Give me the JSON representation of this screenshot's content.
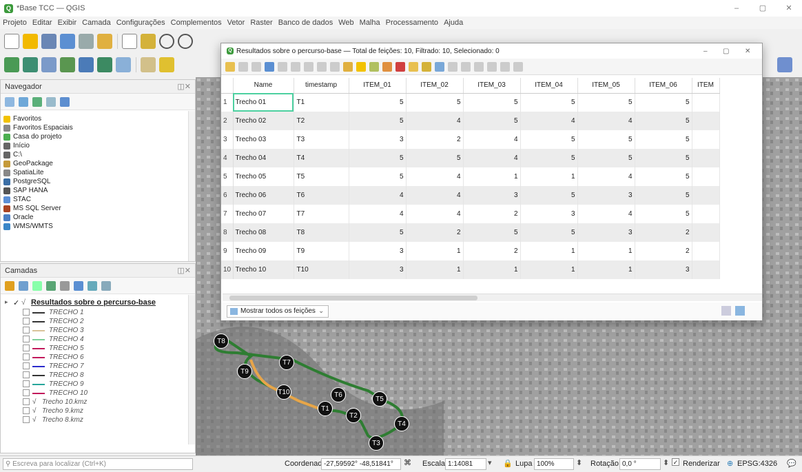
{
  "window": {
    "title": "*Base TCC — QGIS",
    "minimize": "–",
    "restore": "▢",
    "close": "✕"
  },
  "menu": [
    "Projeto",
    "Editar",
    "Exibir",
    "Camada",
    "Configurações",
    "Complementos",
    "Vetor",
    "Raster",
    "Banco de dados",
    "Web",
    "Malha",
    "Processamento",
    "Ajuda"
  ],
  "navigator": {
    "title": "Navegador",
    "items": [
      {
        "label": "Favoritos",
        "icon": "star-icon",
        "color": "#f2c200"
      },
      {
        "label": "Favoritos Espaciais",
        "icon": "spatial-bookmark-icon",
        "color": "#888"
      },
      {
        "label": "Casa do projeto",
        "icon": "project-home-icon",
        "color": "#4caf50"
      },
      {
        "label": "Início",
        "icon": "home-icon",
        "color": "#666"
      },
      {
        "label": "C:\\",
        "icon": "drive-icon",
        "color": "#666"
      },
      {
        "label": "GeoPackage",
        "icon": "geopackage-icon",
        "color": "#c59a3a"
      },
      {
        "label": "SpatiaLite",
        "icon": "spatialite-icon",
        "color": "#888"
      },
      {
        "label": "PostgreSQL",
        "icon": "postgresql-icon",
        "color": "#3b6ea5"
      },
      {
        "label": "SAP HANA",
        "icon": "sap-hana-icon",
        "color": "#555"
      },
      {
        "label": "STAC",
        "icon": "stac-icon",
        "color": "#5b8fd6"
      },
      {
        "label": "MS SQL Server",
        "icon": "mssql-icon",
        "color": "#a42"
      },
      {
        "label": "Oracle",
        "icon": "oracle-icon",
        "color": "#4a7fc4"
      },
      {
        "label": "WMS/WMTS",
        "icon": "wms-icon",
        "color": "#3a86c8"
      }
    ]
  },
  "layers": {
    "title": "Camadas",
    "group": "Resultados sobre o percurso-base",
    "items": [
      {
        "label": "TRECHO 1",
        "color": "#333333"
      },
      {
        "label": "TRECHO 2",
        "color": "#333333"
      },
      {
        "label": "TRECHO 3",
        "color": "#d9c39a"
      },
      {
        "label": "TRECHO 4",
        "color": "#7fcf9a"
      },
      {
        "label": "TRECHO 5",
        "color": "#c2185b"
      },
      {
        "label": "TRECHO 6",
        "color": "#c2185b"
      },
      {
        "label": "TRECHO 7",
        "color": "#2a2acc"
      },
      {
        "label": "TRECHO 8",
        "color": "#333333"
      },
      {
        "label": "TRECHO 9",
        "color": "#26a69a"
      },
      {
        "label": "TRECHO 10",
        "color": "#c2185b"
      }
    ],
    "extra": [
      "Trecho 10.kmz",
      "Trecho 9.kmz",
      "Trecho 8.kmz"
    ]
  },
  "search": {
    "placeholder": "Escreva para localizar (Ctrl+K)"
  },
  "attr": {
    "title": "Resultados sobre o percurso-base — Total de feições: 10, Filtrado: 10, Selecionado: 0",
    "columns": [
      "Name",
      "timestamp",
      "ITEM_01",
      "ITEM_02",
      "ITEM_03",
      "ITEM_04",
      "ITEM_05",
      "ITEM_06",
      "ITEM"
    ],
    "rows": [
      {
        "n": "1",
        "name": "Trecho 01",
        "ts": "T1",
        "v": [
          "5",
          "5",
          "5",
          "5",
          "5",
          "5"
        ]
      },
      {
        "n": "2",
        "name": "Trecho 02",
        "ts": "T2",
        "v": [
          "5",
          "4",
          "5",
          "4",
          "4",
          "5"
        ]
      },
      {
        "n": "3",
        "name": "Trecho 03",
        "ts": "T3",
        "v": [
          "3",
          "2",
          "4",
          "5",
          "5",
          "5"
        ]
      },
      {
        "n": "4",
        "name": "Trecho 04",
        "ts": "T4",
        "v": [
          "5",
          "5",
          "4",
          "5",
          "5",
          "5"
        ]
      },
      {
        "n": "5",
        "name": "Trecho 05",
        "ts": "T5",
        "v": [
          "5",
          "4",
          "1",
          "1",
          "4",
          "5"
        ]
      },
      {
        "n": "6",
        "name": "Trecho 06",
        "ts": "T6",
        "v": [
          "4",
          "4",
          "3",
          "5",
          "3",
          "5"
        ]
      },
      {
        "n": "7",
        "name": "Trecho 07",
        "ts": "T7",
        "v": [
          "4",
          "4",
          "2",
          "3",
          "4",
          "5"
        ]
      },
      {
        "n": "8",
        "name": "Trecho 08",
        "ts": "T8",
        "v": [
          "5",
          "2",
          "5",
          "5",
          "3",
          "2"
        ]
      },
      {
        "n": "9",
        "name": "Trecho 09",
        "ts": "T9",
        "v": [
          "3",
          "1",
          "2",
          "1",
          "1",
          "2"
        ]
      },
      {
        "n": "10",
        "name": "Trecho 10",
        "ts": "T10",
        "v": [
          "3",
          "1",
          "1",
          "1",
          "1",
          "3"
        ]
      }
    ],
    "showall": "Mostrar todos os feições"
  },
  "map": {
    "markers": [
      "T8",
      "T7",
      "T9",
      "T10",
      "T6",
      "T5",
      "T1",
      "T2",
      "T4",
      "T3"
    ]
  },
  "status": {
    "coord_label": "Coordenada",
    "coord": "-27,59592° -48,51841°",
    "scale_label": "Escala",
    "scale": "1:14081",
    "lupa_label": "Lupa",
    "lupa": "100%",
    "rot_label": "Rotação",
    "rot": "0,0 °",
    "render": "Renderizar",
    "epsg": "EPSG:4326"
  }
}
